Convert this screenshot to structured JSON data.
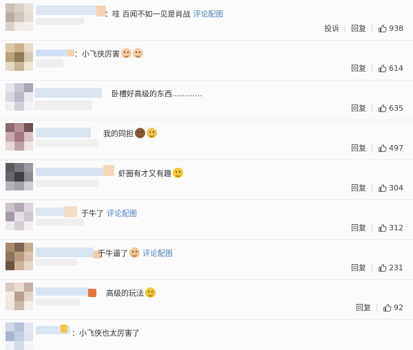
{
  "comments": [
    {
      "text": "：哇 百闻不如一见是肖战",
      "pic_link": "评论配图",
      "emojis": [],
      "report": "投诉",
      "reply": "回复",
      "likes": "938"
    },
    {
      "text": "：小飞侠厉害",
      "pic_link": "",
      "emojis": [
        "dog-face-emoji",
        "dog-face-emoji"
      ],
      "report": "",
      "reply": "回复",
      "likes": "614"
    },
    {
      "text": "卧槽好高级的东西…………",
      "pic_link": "",
      "emojis": [],
      "report": "",
      "reply": "回复",
      "likes": "635"
    },
    {
      "text": "我的同担",
      "pic_link": "",
      "emojis": [
        "cat-face-emoji",
        "beer-emoji"
      ],
      "report": "",
      "reply": "回复",
      "likes": "497"
    },
    {
      "text": "虾圈有才又有趣",
      "pic_link": "",
      "emojis": [
        "laughing-emoji"
      ],
      "report": "",
      "reply": "回复",
      "likes": "304"
    },
    {
      "text": "于牛了",
      "pic_link": "评论配图",
      "emojis": [],
      "report": "",
      "reply": "回复",
      "likes": "312"
    },
    {
      "text": "于牛逼了",
      "pic_link": "评论配图",
      "emojis": [
        "praying-hands-emoji"
      ],
      "report": "",
      "reply": "回复",
      "likes": "231"
    },
    {
      "text": "高级的玩法",
      "pic_link": "",
      "emojis": [
        "laughing-tears-emoji"
      ],
      "report": "",
      "reply": "回复",
      "likes": "92"
    },
    {
      "text": "：小飞侠也太厉害了",
      "pic_link": "",
      "emojis": [],
      "report": "",
      "reply": "",
      "likes": ""
    }
  ],
  "colors": {
    "link": "#4b7fbd",
    "text": "#333333",
    "muted": "#444444"
  }
}
